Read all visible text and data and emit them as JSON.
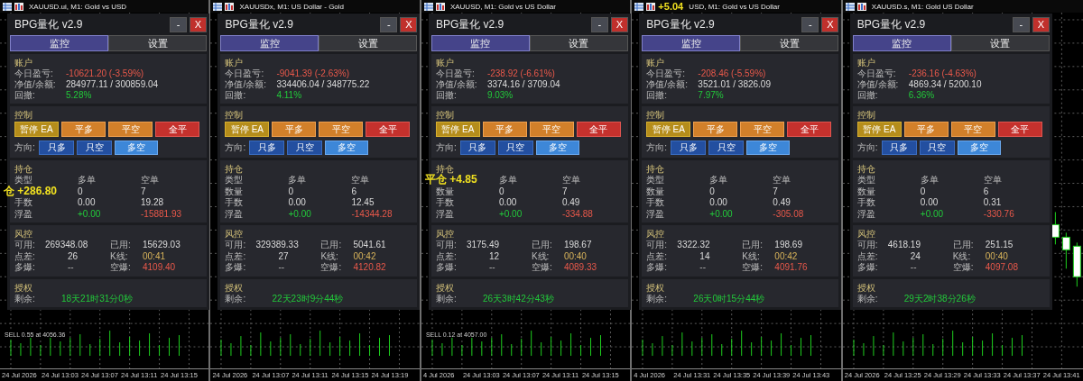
{
  "windows": [
    {
      "title": "XAUUSD.ui, M1: Gold vs USD",
      "panel": {
        "title": "BPG量化 v2.9",
        "minimize": "-",
        "close": "X",
        "tabs": [
          {
            "label": "监控",
            "selected": true
          },
          {
            "label": "设置",
            "selected": false
          }
        ],
        "account": {
          "title": "账户",
          "items": [
            {
              "label": "今日盈亏:",
              "value": "-10621.20 (-3.59%)",
              "kind": "negative"
            },
            {
              "label": "净值/余额:",
              "value": "284977.11 / 300859.04",
              "kind": "neutral"
            },
            {
              "label": "回撤:",
              "value": "5.28%",
              "kind": "positive"
            }
          ]
        },
        "control": {
          "title": "控制",
          "buttons": [
            {
              "label": "暂停 EA",
              "kind": "pause"
            },
            {
              "label": "平多",
              "kind": "close_long"
            },
            {
              "label": "平空",
              "kind": "close_short"
            },
            {
              "label": "全平",
              "kind": "close_all"
            }
          ],
          "direction_label": "方向:",
          "direction": [
            {
              "label": "只多",
              "selected": false
            },
            {
              "label": "只空",
              "selected": false
            },
            {
              "label": "多空",
              "selected": true
            }
          ]
        },
        "positions": {
          "title": "持仓",
          "header": {
            "label": "类型",
            "columns": [
              "多单",
              "空单"
            ]
          },
          "rows": [
            {
              "overlay": "仓 +286.80",
              "values": [
                {
                  "text": "0",
                  "kind": "neutral"
                },
                {
                  "text": "7",
                  "kind": "neutral"
                }
              ]
            },
            {
              "label": "手数",
              "values": [
                {
                  "text": "0.00",
                  "kind": "neutral"
                },
                {
                  "text": "19.28",
                  "kind": "neutral"
                }
              ]
            },
            {
              "label": "浮盈",
              "values": [
                {
                  "text": "+0.00",
                  "kind": "positive"
                },
                {
                  "text": "-15881.93",
                  "kind": "negative"
                }
              ]
            }
          ]
        },
        "risk": {
          "title": "风控",
          "items": [
            {
              "label": "可用:",
              "value": "269348.08",
              "kind": "neutral"
            },
            {
              "label": "已用:",
              "value": "15629.03",
              "kind": "neutral"
            },
            {
              "label": "点差:",
              "value": "26",
              "kind": "neutral"
            },
            {
              "label": "K线:",
              "value": "00:41",
              "kind": "accent"
            },
            {
              "label": "多爆:",
              "value": "--",
              "kind": "muted"
            },
            {
              "label": "空爆:",
              "value": "4109.40",
              "kind": "negative"
            }
          ]
        },
        "license": {
          "title": "授权",
          "label": "剩余:",
          "value": "18天21时31分0秒"
        }
      },
      "chart": {
        "trade_label": "SELL 0.55 at 4056.36",
        "time_labels": [
          "24 Jul 2026",
          "24 Jul 13:03",
          "24 Jul 13:07",
          "24 Jul 13:11",
          "24 Jul 13:15"
        ]
      }
    },
    {
      "title": "XAUUSDx, M1: US Dollar - Gold",
      "panel": {
        "title": "BPG量化 v2.9",
        "minimize": "-",
        "close": "X",
        "tabs": [
          {
            "label": "监控",
            "selected": true
          },
          {
            "label": "设置",
            "selected": false
          }
        ],
        "account": {
          "title": "账户",
          "items": [
            {
              "label": "今日盈亏:",
              "value": "-9041.39 (-2.63%)",
              "kind": "negative"
            },
            {
              "label": "净值/余额:",
              "value": "334406.04 / 348775.22",
              "kind": "neutral"
            },
            {
              "label": "回撤:",
              "value": "4.11%",
              "kind": "positive"
            }
          ]
        },
        "control": {
          "title": "控制",
          "buttons": [
            {
              "label": "暂停 EA",
              "kind": "pause"
            },
            {
              "label": "平多",
              "kind": "close_long"
            },
            {
              "label": "平空",
              "kind": "close_short"
            },
            {
              "label": "全平",
              "kind": "close_all"
            }
          ],
          "direction_label": "方向:",
          "direction": [
            {
              "label": "只多",
              "selected": false
            },
            {
              "label": "只空",
              "selected": false
            },
            {
              "label": "多空",
              "selected": true
            }
          ]
        },
        "positions": {
          "title": "持仓",
          "header": {
            "label": "类型",
            "columns": [
              "多单",
              "空单"
            ]
          },
          "rows": [
            {
              "label": "数量",
              "values": [
                {
                  "text": "0",
                  "kind": "neutral"
                },
                {
                  "text": "6",
                  "kind": "neutral"
                }
              ]
            },
            {
              "label": "手数",
              "values": [
                {
                  "text": "0.00",
                  "kind": "neutral"
                },
                {
                  "text": "12.45",
                  "kind": "neutral"
                }
              ]
            },
            {
              "label": "浮盈",
              "values": [
                {
                  "text": "+0.00",
                  "kind": "positive"
                },
                {
                  "text": "-14344.28",
                  "kind": "negative"
                }
              ]
            }
          ]
        },
        "risk": {
          "title": "风控",
          "items": [
            {
              "label": "可用:",
              "value": "329389.33",
              "kind": "neutral"
            },
            {
              "label": "已用:",
              "value": "5041.61",
              "kind": "neutral"
            },
            {
              "label": "点差:",
              "value": "27",
              "kind": "neutral"
            },
            {
              "label": "K线:",
              "value": "00:42",
              "kind": "accent"
            },
            {
              "label": "多爆:",
              "value": "--",
              "kind": "muted"
            },
            {
              "label": "空爆:",
              "value": "4120.82",
              "kind": "negative"
            }
          ]
        },
        "license": {
          "title": "授权",
          "label": "剩余:",
          "value": "22天23时9分44秒"
        }
      },
      "chart": {
        "time_labels": [
          "24 Jul 2026",
          "24 Jul 13:07",
          "24 Jul 13:11",
          "24 Jul 13:15",
          "24 Jul 13:19"
        ]
      }
    },
    {
      "title": "XAUUSD, M1: Gold vs US Dollar",
      "panel": {
        "title": "BPG量化 v2.9",
        "minimize": "-",
        "close": "X",
        "tabs": [
          {
            "label": "监控",
            "selected": true
          },
          {
            "label": "设置",
            "selected": false
          }
        ],
        "account": {
          "title": "账户",
          "items": [
            {
              "label": "今日盈亏:",
              "value": "-238.92 (-6.61%)",
              "kind": "negative"
            },
            {
              "label": "净值/余额:",
              "value": "3374.16 / 3709.04",
              "kind": "neutral"
            },
            {
              "label": "回撤:",
              "value": "9.03%",
              "kind": "positive"
            }
          ]
        },
        "control": {
          "title": "控制",
          "buttons": [
            {
              "label": "暂停 EA",
              "kind": "pause"
            },
            {
              "label": "平多",
              "kind": "close_long"
            },
            {
              "label": "平空",
              "kind": "close_short"
            },
            {
              "label": "全平",
              "kind": "close_all"
            }
          ],
          "direction_label": "方向:",
          "direction": [
            {
              "label": "只多",
              "selected": false
            },
            {
              "label": "只空",
              "selected": false
            },
            {
              "label": "多空",
              "selected": true
            }
          ]
        },
        "positions": {
          "title": "持仓",
          "header": {
            "overlay": "平仓 +4.85",
            "columns": [
              "多单",
              "空单"
            ]
          },
          "rows": [
            {
              "label": "数量",
              "values": [
                {
                  "text": "0",
                  "kind": "neutral"
                },
                {
                  "text": "7",
                  "kind": "neutral"
                }
              ]
            },
            {
              "label": "手数",
              "values": [
                {
                  "text": "0.00",
                  "kind": "neutral"
                },
                {
                  "text": "0.49",
                  "kind": "neutral"
                }
              ]
            },
            {
              "label": "浮盈",
              "values": [
                {
                  "text": "+0.00",
                  "kind": "positive"
                },
                {
                  "text": "-334.88",
                  "kind": "negative"
                }
              ]
            }
          ]
        },
        "risk": {
          "title": "风控",
          "items": [
            {
              "label": "可用:",
              "value": "3175.49",
              "kind": "neutral"
            },
            {
              "label": "已用:",
              "value": "198.67",
              "kind": "neutral"
            },
            {
              "label": "点差:",
              "value": "12",
              "kind": "neutral"
            },
            {
              "label": "K线:",
              "value": "00:40",
              "kind": "accent"
            },
            {
              "label": "多爆:",
              "value": "--",
              "kind": "muted"
            },
            {
              "label": "空爆:",
              "value": "4089.33",
              "kind": "negative"
            }
          ]
        },
        "license": {
          "title": "授权",
          "label": "剩余:",
          "value": "26天3时42分43秒"
        }
      },
      "chart": {
        "trade_label": "SELL 0.12 at 4057.00",
        "time_labels": [
          "4 Jul 2026",
          "24 Jul 13:03",
          "24 Jul 13:07",
          "24 Jul 13:11",
          "24 Jul 13:15"
        ]
      }
    },
    {
      "title": "USD, M1: Gold vs US Dollar",
      "title_overlay": "+5.04",
      "panel": {
        "title": "BPG量化 v2.9",
        "minimize": "-",
        "close": "X",
        "tabs": [
          {
            "label": "监控",
            "selected": true
          },
          {
            "label": "设置",
            "selected": false
          }
        ],
        "account": {
          "title": "账户",
          "items": [
            {
              "label": "今日盈亏:",
              "value": "-208.46 (-5.59%)",
              "kind": "negative"
            },
            {
              "label": "净值/余额:",
              "value": "3521.01 / 3826.09",
              "kind": "neutral"
            },
            {
              "label": "回撤:",
              "value": "7.97%",
              "kind": "positive"
            }
          ]
        },
        "control": {
          "title": "控制",
          "buttons": [
            {
              "label": "暂停 EA",
              "kind": "pause"
            },
            {
              "label": "平多",
              "kind": "close_long"
            },
            {
              "label": "平空",
              "kind": "close_short"
            },
            {
              "label": "全平",
              "kind": "close_all"
            }
          ],
          "direction_label": "方向:",
          "direction": [
            {
              "label": "只多",
              "selected": false
            },
            {
              "label": "只空",
              "selected": false
            },
            {
              "label": "多空",
              "selected": true
            }
          ]
        },
        "positions": {
          "title": "持仓",
          "header": {
            "label": "类型",
            "columns": [
              "多单",
              "空单"
            ]
          },
          "rows": [
            {
              "label": "数量",
              "values": [
                {
                  "text": "0",
                  "kind": "neutral"
                },
                {
                  "text": "7",
                  "kind": "neutral"
                }
              ]
            },
            {
              "label": "手数",
              "values": [
                {
                  "text": "0.00",
                  "kind": "neutral"
                },
                {
                  "text": "0.49",
                  "kind": "neutral"
                }
              ]
            },
            {
              "label": "浮盈",
              "values": [
                {
                  "text": "+0.00",
                  "kind": "positive"
                },
                {
                  "text": "-305.08",
                  "kind": "negative"
                }
              ]
            }
          ]
        },
        "risk": {
          "title": "风控",
          "items": [
            {
              "label": "可用:",
              "value": "3322.32",
              "kind": "neutral"
            },
            {
              "label": "已用:",
              "value": "198.69",
              "kind": "neutral"
            },
            {
              "label": "点差:",
              "value": "14",
              "kind": "neutral"
            },
            {
              "label": "K线:",
              "value": "00:42",
              "kind": "accent"
            },
            {
              "label": "多爆:",
              "value": "--",
              "kind": "muted"
            },
            {
              "label": "空爆:",
              "value": "4091.76",
              "kind": "negative"
            }
          ]
        },
        "license": {
          "title": "授权",
          "label": "剩余:",
          "value": "26天0时15分44秒"
        }
      },
      "chart": {
        "time_labels": [
          "4 Jul 2026",
          "24 Jul 13:31",
          "24 Jul 13:35",
          "24 Jul 13:39",
          "24 Jul 13:43"
        ]
      }
    },
    {
      "title": "XAUUSD.s, M1: Gold US Dollar",
      "panel": {
        "title": "BPG量化 v2.9",
        "minimize": "-",
        "close": "X",
        "tabs": [
          {
            "label": "监控",
            "selected": true
          },
          {
            "label": "设置",
            "selected": false
          }
        ],
        "account": {
          "title": "账户",
          "items": [
            {
              "label": "今日盈亏:",
              "value": "-236.16 (-4.63%)",
              "kind": "negative"
            },
            {
              "label": "净值/余额:",
              "value": "4869.34 / 5200.10",
              "kind": "neutral"
            },
            {
              "label": "回撤:",
              "value": "6.36%",
              "kind": "positive"
            }
          ]
        },
        "control": {
          "title": "控制",
          "buttons": [
            {
              "label": "暂停 EA",
              "kind": "pause"
            },
            {
              "label": "平多",
              "kind": "close_long"
            },
            {
              "label": "平空",
              "kind": "close_short"
            },
            {
              "label": "全平",
              "kind": "close_all"
            }
          ],
          "direction_label": "方向:",
          "direction": [
            {
              "label": "只多",
              "selected": false
            },
            {
              "label": "只空",
              "selected": false
            },
            {
              "label": "多空",
              "selected": true
            }
          ]
        },
        "positions": {
          "title": "持仓",
          "header": {
            "label": "类型",
            "columns": [
              "多单",
              "空单"
            ]
          },
          "rows": [
            {
              "label": "数量",
              "values": [
                {
                  "text": "0",
                  "kind": "neutral"
                },
                {
                  "text": "6",
                  "kind": "neutral"
                }
              ]
            },
            {
              "label": "手数",
              "values": [
                {
                  "text": "0.00",
                  "kind": "neutral"
                },
                {
                  "text": "0.31",
                  "kind": "neutral"
                }
              ]
            },
            {
              "label": "浮盈",
              "values": [
                {
                  "text": "+0.00",
                  "kind": "positive"
                },
                {
                  "text": "-330.76",
                  "kind": "negative"
                }
              ]
            }
          ]
        },
        "risk": {
          "title": "风控",
          "items": [
            {
              "label": "可用:",
              "value": "4618.19",
              "kind": "neutral"
            },
            {
              "label": "已用:",
              "value": "251.15",
              "kind": "neutral"
            },
            {
              "label": "点差:",
              "value": "24",
              "kind": "neutral"
            },
            {
              "label": "K线:",
              "value": "00:40",
              "kind": "accent"
            },
            {
              "label": "多爆:",
              "value": "--",
              "kind": "muted"
            },
            {
              "label": "空爆:",
              "value": "4097.08",
              "kind": "negative"
            }
          ]
        },
        "license": {
          "title": "授权",
          "label": "剩余:",
          "value": "29天2时38分26秒"
        }
      },
      "chart": {
        "candles": true,
        "time_labels": [
          "24 Jul 2026",
          "24 Jul 13:25",
          "24 Jul 13:29",
          "24 Jul 13:33",
          "24 Jul 13:37",
          "24 Jul 13:41"
        ]
      }
    }
  ]
}
